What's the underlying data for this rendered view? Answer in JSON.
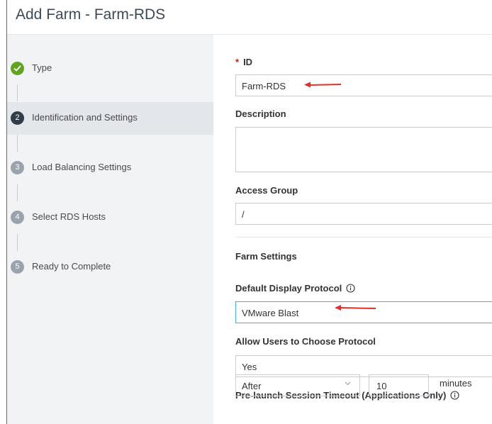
{
  "title": "Add Farm - Farm-RDS",
  "steps": [
    {
      "num": "1",
      "label": "Type",
      "state": "done"
    },
    {
      "num": "2",
      "label": "Identification and Settings",
      "state": "current"
    },
    {
      "num": "3",
      "label": "Load Balancing Settings",
      "state": "todo"
    },
    {
      "num": "4",
      "label": "Select RDS Hosts",
      "state": "todo"
    },
    {
      "num": "5",
      "label": "Ready to Complete",
      "state": "todo"
    }
  ],
  "form": {
    "id_required_mark": "*",
    "id_label": "ID",
    "id_value": "Farm-RDS",
    "description_label": "Description",
    "description_value": "",
    "access_group_label": "Access Group",
    "access_group_value": "/",
    "section_heading": "Farm Settings",
    "protocol_label": "Default Display Protocol",
    "protocol_value": "VMware Blast",
    "allow_label": "Allow Users to Choose Protocol",
    "allow_value": "Yes",
    "prelaunch_label": "Pre-launch Session Timeout (Applications Only)",
    "prelaunch_select": "After",
    "prelaunch_minutes": "10",
    "prelaunch_unit": "minutes"
  },
  "icons": {
    "check": "check-icon",
    "info": "info-icon",
    "arrow": "red-arrow-annotation",
    "chevron": "chevron-down-icon"
  },
  "colors": {
    "done": "#62a420",
    "current": "#313c48",
    "todo": "#9aa3ad",
    "required": "#c92100",
    "focus": "#49afd9",
    "annotation": "#e0312b"
  }
}
